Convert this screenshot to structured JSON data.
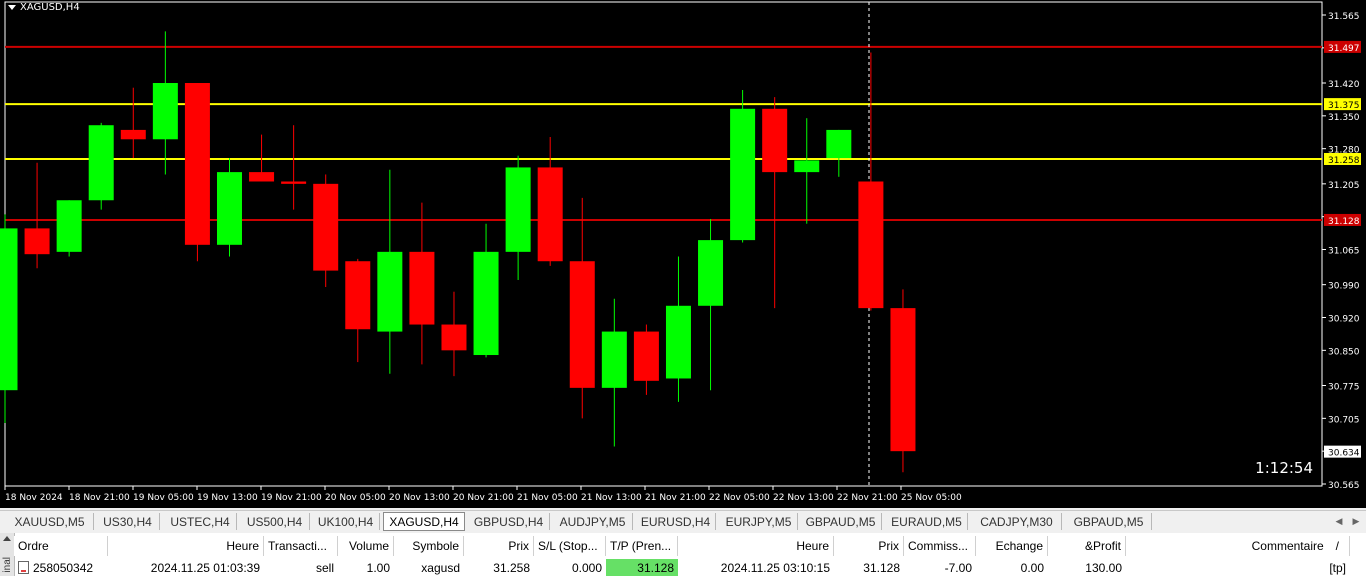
{
  "chart": {
    "title": "XAGUSD,H4",
    "timer": "1:12:54",
    "price_min": 30.565,
    "price_max": 31.565,
    "price_ticks": [
      "31.565",
      "31.495",
      "31.420",
      "31.350",
      "31.280",
      "31.205",
      "31.135",
      "31.065",
      "30.990",
      "30.920",
      "30.850",
      "30.775",
      "30.705",
      "30.635",
      "30.565"
    ],
    "time_labels": [
      "18 Nov 2024",
      "18 Nov 21:00",
      "19 Nov 05:00",
      "19 Nov 13:00",
      "19 Nov 21:00",
      "20 Nov 05:00",
      "20 Nov 13:00",
      "20 Nov 21:00",
      "21 Nov 05:00",
      "21 Nov 13:00",
      "21 Nov 21:00",
      "22 Nov 05:00",
      "22 Nov 13:00",
      "22 Nov 21:00",
      "25 Nov 05:00"
    ],
    "colors": {
      "bull": "#00ff00",
      "bear": "#ff0000",
      "background": "#000000",
      "text": "#ffffff",
      "red_line": "#cc0000",
      "yellow_line": "#ffff00"
    },
    "levels": [
      {
        "price": 31.497,
        "label": "31.497",
        "color": "#cc0000",
        "label_bg": "#cc0000",
        "label_color": "#ffffff"
      },
      {
        "price": 31.375,
        "label": "31.375",
        "color": "#ffff00",
        "label_bg": "#ffff00",
        "label_color": "#000000"
      },
      {
        "price": 31.258,
        "label": "31.258",
        "color": "#ffff00",
        "label_bg": "#ffff00",
        "label_color": "#000000"
      },
      {
        "price": 31.128,
        "label": "31.128",
        "color": "#cc0000",
        "label_bg": "#cc0000",
        "label_color": "#ffffff"
      }
    ],
    "current_price": {
      "price": 30.634,
      "label": "30.634"
    },
    "candles": [
      {
        "o": 30.765,
        "h": 31.14,
        "l": 30.695,
        "c": 31.11
      },
      {
        "o": 31.11,
        "h": 31.25,
        "l": 31.025,
        "c": 31.055
      },
      {
        "o": 31.06,
        "h": 31.17,
        "l": 31.05,
        "c": 31.17
      },
      {
        "o": 31.17,
        "h": 31.335,
        "l": 31.15,
        "c": 31.33
      },
      {
        "o": 31.32,
        "h": 31.41,
        "l": 31.26,
        "c": 31.3
      },
      {
        "o": 31.3,
        "h": 31.53,
        "l": 31.225,
        "c": 31.42
      },
      {
        "o": 31.42,
        "h": 31.41,
        "l": 31.04,
        "c": 31.075
      },
      {
        "o": 31.075,
        "h": 31.26,
        "l": 31.05,
        "c": 31.23
      },
      {
        "o": 31.23,
        "h": 31.31,
        "l": 31.21,
        "c": 31.21
      },
      {
        "o": 31.21,
        "h": 31.33,
        "l": 31.15,
        "c": 31.205
      },
      {
        "o": 31.205,
        "h": 31.225,
        "l": 30.985,
        "c": 31.02
      },
      {
        "o": 31.04,
        "h": 31.045,
        "l": 30.825,
        "c": 30.895
      },
      {
        "o": 30.89,
        "h": 31.235,
        "l": 30.8,
        "c": 31.06
      },
      {
        "o": 31.06,
        "h": 31.165,
        "l": 30.82,
        "c": 30.905
      },
      {
        "o": 30.905,
        "h": 30.975,
        "l": 30.795,
        "c": 30.85
      },
      {
        "o": 30.84,
        "h": 31.12,
        "l": 30.835,
        "c": 31.06
      },
      {
        "o": 31.06,
        "h": 31.265,
        "l": 31.0,
        "c": 31.24
      },
      {
        "o": 31.24,
        "h": 31.305,
        "l": 31.03,
        "c": 31.04
      },
      {
        "o": 31.04,
        "h": 31.175,
        "l": 30.705,
        "c": 30.77
      },
      {
        "o": 30.77,
        "h": 30.96,
        "l": 30.645,
        "c": 30.89
      },
      {
        "o": 30.89,
        "h": 30.905,
        "l": 30.755,
        "c": 30.785
      },
      {
        "o": 30.79,
        "h": 31.05,
        "l": 30.74,
        "c": 30.945
      },
      {
        "o": 30.945,
        "h": 31.13,
        "l": 30.765,
        "c": 31.085
      },
      {
        "o": 31.085,
        "h": 31.405,
        "l": 31.08,
        "c": 31.365
      },
      {
        "o": 31.365,
        "h": 31.39,
        "l": 30.94,
        "c": 31.23
      },
      {
        "o": 31.23,
        "h": 31.345,
        "l": 31.12,
        "c": 31.255
      },
      {
        "o": 31.26,
        "h": 31.32,
        "l": 31.22,
        "c": 31.32
      },
      {
        "o": 31.21,
        "h": 31.485,
        "l": 30.935,
        "c": 30.94
      },
      {
        "o": 30.94,
        "h": 30.98,
        "l": 30.59,
        "c": 30.635
      }
    ]
  },
  "symbol_tabs": [
    {
      "label": "XAUUSD,M5",
      "active": false
    },
    {
      "label": "US30,H4",
      "active": false
    },
    {
      "label": "USTEC,H4",
      "active": false
    },
    {
      "label": "US500,H4",
      "active": false
    },
    {
      "label": "UK100,H4",
      "active": false
    },
    {
      "label": "XAGUSD,H4",
      "active": true
    },
    {
      "label": "GBPUSD,H4",
      "active": false
    },
    {
      "label": "AUDJPY,M5",
      "active": false
    },
    {
      "label": "EURUSD,H4",
      "active": false
    },
    {
      "label": "EURJPY,M5",
      "active": false
    },
    {
      "label": "GBPAUD,M5",
      "active": false
    },
    {
      "label": "EURAUD,M5",
      "active": false
    },
    {
      "label": "CADJPY,M30",
      "active": false
    },
    {
      "label": "GBPAUD,M5",
      "active": false
    }
  ],
  "terminal": {
    "side_label": "inal",
    "columns": [
      "Ordre",
      "Heure",
      "Transacti...",
      "Volume",
      "Symbole",
      "Prix",
      "S/L (Stop...",
      "T/P (Pren...",
      "Heure",
      "Prix",
      "Commiss...",
      "Echange",
      "&Profit",
      "Commentaire"
    ],
    "sort_indicator": "/",
    "row": {
      "order": "258050342",
      "open_time": "2024.11.25 01:03:39",
      "type": "sell",
      "volume": "1.00",
      "symbol": "xagusd",
      "open_price": "31.258",
      "sl": "0.000",
      "tp": "31.128",
      "close_time": "2024.11.25 03:10:15",
      "close_price": "31.128",
      "commission": "-7.00",
      "swap": "0.00",
      "profit": "130.00",
      "comment": "[tp]"
    }
  }
}
